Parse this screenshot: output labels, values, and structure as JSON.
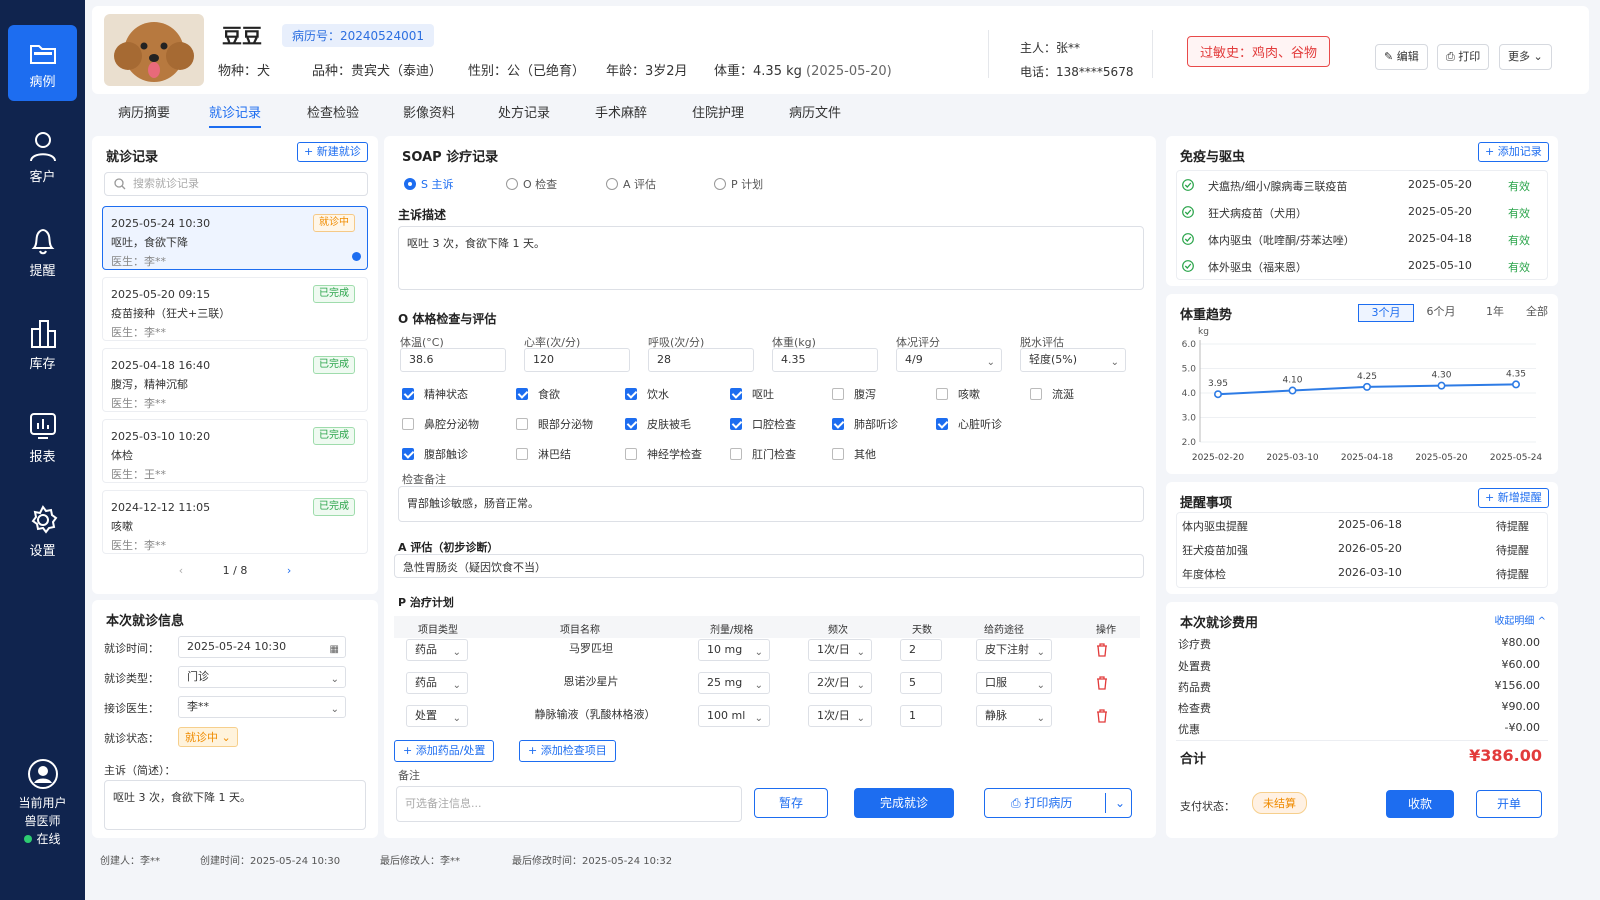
{
  "nav": {
    "items": [
      {
        "label": "病例",
        "icon": "folder-icon"
      },
      {
        "label": "客户",
        "icon": "user-icon"
      },
      {
        "label": "提醒",
        "icon": "bell-icon"
      },
      {
        "label": "库存",
        "icon": "building-icon"
      },
      {
        "label": "报表",
        "icon": "chart-icon"
      },
      {
        "label": "设置",
        "icon": "gear-icon"
      }
    ],
    "user_title": "当前用户",
    "user_role": "兽医师",
    "user_status": "在线"
  },
  "header": {
    "pet_name": "豆豆",
    "case_number": "病历号：20240524001",
    "species_label": "物种：",
    "species": "犬",
    "breed_label": "品种：",
    "breed": "贵宾犬（泰迪）",
    "sex_label": "性别：",
    "sex": "公（已绝育）",
    "age_label": "年龄：",
    "age": "3岁2月",
    "weight_label": "体重：",
    "weight": "4.35 kg",
    "weight_date": "(2025-05-20)",
    "owner_label": "主人：",
    "owner": "张**",
    "phone_label": "电话：",
    "phone": "138****5678",
    "allergy": "过敏史：鸡肉、谷物",
    "edit_label": "编辑",
    "print_label": "打印",
    "more_label": "更多"
  },
  "tabs": [
    "病历摘要",
    "就诊记录",
    "检查检验",
    "影像资料",
    "处方记录",
    "手术麻醉",
    "住院护理",
    "病历文件"
  ],
  "visits": {
    "title": "就诊记录",
    "new_label": "+ 新建就诊",
    "search_placeholder": "搜索就诊记录",
    "items": [
      {
        "datetime": "2025-05-24  10:30",
        "summary": "呕吐，食欲下降",
        "doctor": "医生：李**",
        "status": "就诊中"
      },
      {
        "datetime": "2025-05-20  09:15",
        "summary": "疫苗接种（狂犬+三联）",
        "doctor": "医生：李**",
        "status": "已完成"
      },
      {
        "datetime": "2025-04-18  16:40",
        "summary": "腹泻，精神沉郁",
        "doctor": "医生：李**",
        "status": "已完成"
      },
      {
        "datetime": "2025-03-10  10:20",
        "summary": "体检",
        "doctor": "医生：王**",
        "status": "已完成"
      },
      {
        "datetime": "2024-12-12  11:05",
        "summary": "咳嗽",
        "doctor": "医生：李**",
        "status": "已完成"
      }
    ],
    "pager": "1 / 8"
  },
  "current_visit": {
    "title": "本次就诊信息",
    "time_label": "就诊时间：",
    "time": "2025-05-24   10:30",
    "type_label": "就诊类型：",
    "type": "门诊",
    "doctor_label": "接诊医生：",
    "doctor": "李**",
    "status_label": "就诊状态：",
    "status": "就诊中",
    "complaint_label": "主诉（简述）：",
    "complaint": "呕吐 3 次，食欲下降 1 天。"
  },
  "soap": {
    "title": "SOAP 诊疗记录",
    "radios": [
      "S 主诉",
      "O 检查",
      "A 评估",
      "P 计划"
    ],
    "s_title": "主诉描述",
    "s_text": "呕吐 3 次，食欲下降 1 天。",
    "o_title": "O 体格检查与评估",
    "vitals": [
      {
        "label": "体温(°C)",
        "value": "38.6"
      },
      {
        "label": "心率(次/分)",
        "value": "120"
      },
      {
        "label": "呼吸(次/分)",
        "value": "28"
      },
      {
        "label": "体重(kg)",
        "value": "4.35"
      },
      {
        "label": "体况评分",
        "value": "4/9"
      },
      {
        "label": "脱水评估",
        "value": "轻度(5%)"
      }
    ],
    "checks": [
      {
        "label": "精神状态",
        "on": true
      },
      {
        "label": "食欲",
        "on": true
      },
      {
        "label": "饮水",
        "on": true
      },
      {
        "label": "呕吐",
        "on": true
      },
      {
        "label": "腹泻",
        "on": false
      },
      {
        "label": "咳嗽",
        "on": false
      },
      {
        "label": "流涎",
        "on": false
      },
      {
        "label": "鼻腔分泌物",
        "on": false
      },
      {
        "label": "眼部分泌物",
        "on": false
      },
      {
        "label": "皮肤被毛",
        "on": true
      },
      {
        "label": "口腔检查",
        "on": true
      },
      {
        "label": "肺部听诊",
        "on": true
      },
      {
        "label": "心脏听诊",
        "on": true
      },
      {
        "label": "腹部触诊",
        "on": true
      },
      {
        "label": "淋巴结",
        "on": false
      },
      {
        "label": "神经学检查",
        "on": false
      },
      {
        "label": "肛门检查",
        "on": false
      },
      {
        "label": "其他",
        "on": false
      }
    ],
    "exam_note_label": "检查备注",
    "exam_note": "胃部触诊敏感，肠音正常。",
    "a_title": "A 评估（初步诊断）",
    "a_text": "急性胃肠炎（疑因饮食不当）",
    "p_title": "P 治疗计划",
    "plan_headers": [
      "项目类型",
      "项目名称",
      "剂量/规格",
      "频次",
      "天数",
      "给药途径",
      "操作"
    ],
    "plan_rows": [
      {
        "type": "药品",
        "name": "马罗匹坦",
        "dose": "10 mg",
        "freq": "1次/日",
        "days": "2",
        "route": "皮下注射"
      },
      {
        "type": "药品",
        "name": "恩诺沙星片",
        "dose": "25 mg",
        "freq": "2次/日",
        "days": "5",
        "route": "口服"
      },
      {
        "type": "处置",
        "name": "静脉输液（乳酸林格液）",
        "dose": "100 ml",
        "freq": "1次/日",
        "days": "1",
        "route": "静脉"
      }
    ],
    "add_drug": "+ 添加药品/处置",
    "add_exam": "+ 添加检查项目",
    "note_label": "备注",
    "note_placeholder": "可选备注信息...",
    "save_label": "暂存",
    "complete_label": "完成就诊",
    "print_label": "打印病历"
  },
  "immunization": {
    "title": "免疫与驱虫",
    "add_label": "+ 添加记录",
    "items": [
      {
        "name": "犬瘟热/细小/腺病毒三联疫苗",
        "date": "2025-05-20",
        "status": "有效"
      },
      {
        "name": "狂犬病疫苗（犬用）",
        "date": "2025-05-20",
        "status": "有效"
      },
      {
        "name": "体内驱虫（吡喹酮/芬苯达唑）",
        "date": "2025-04-18",
        "status": "有效"
      },
      {
        "name": "体外驱虫（福来恩）",
        "date": "2025-05-10",
        "status": "有效"
      }
    ]
  },
  "weight_trend": {
    "title": "体重趋势",
    "ranges": [
      "3个月",
      "6个月",
      "1年",
      "全部"
    ],
    "selected_range": "3个月"
  },
  "chart_data": {
    "type": "line",
    "x": [
      "2025-02-20",
      "2025-03-10",
      "2025-04-18",
      "2025-05-20",
      "2025-05-24"
    ],
    "values": [
      3.95,
      4.1,
      4.25,
      4.3,
      4.35
    ],
    "ylabel": "kg",
    "ylim": [
      2.0,
      6.0
    ],
    "yticks": [
      "6.0",
      "5.0",
      "4.0",
      "3.0",
      "2.0"
    ],
    "data_labels": [
      "3.95",
      "4.10",
      "4.25",
      "4.30",
      "4.35"
    ],
    "color": "#2d7be5",
    "grid": true
  },
  "reminders": {
    "title": "提醒事项",
    "add_label": "+ 新增提醒",
    "items": [
      {
        "name": "体内驱虫提醒",
        "date": "2025-06-18",
        "status": "待提醒"
      },
      {
        "name": "狂犬疫苗加强",
        "date": "2026-05-20",
        "status": "待提醒"
      },
      {
        "name": "年度体检",
        "date": "2026-03-10",
        "status": "待提醒"
      }
    ]
  },
  "fees": {
    "title": "本次就诊费用",
    "collapse_label": "收起明细 ^",
    "items": [
      {
        "name": "诊疗费",
        "amount": "¥80.00"
      },
      {
        "name": "处置费",
        "amount": "¥60.00"
      },
      {
        "name": "药品费",
        "amount": "¥156.00"
      },
      {
        "name": "检查费",
        "amount": "¥90.00"
      },
      {
        "name": "优惠",
        "amount": "-¥0.00"
      }
    ],
    "total_label": "合计",
    "total": "¥386.00",
    "pay_label": "支付状态：",
    "pay_status": "未结算",
    "collect_label": "收款",
    "invoice_label": "开单"
  },
  "footer": {
    "creator": "创建人：李**",
    "created": "创建时间：2025-05-24 10:30",
    "modifier": "最后修改人：李**",
    "modified": "最后修改时间：2025-05-24 10:32"
  },
  "colors": {
    "primary": "#1d6df0",
    "sidebar": "#10244e",
    "danger": "#e23b3b",
    "success": "#2aa44a",
    "warning": "#f08c00"
  }
}
